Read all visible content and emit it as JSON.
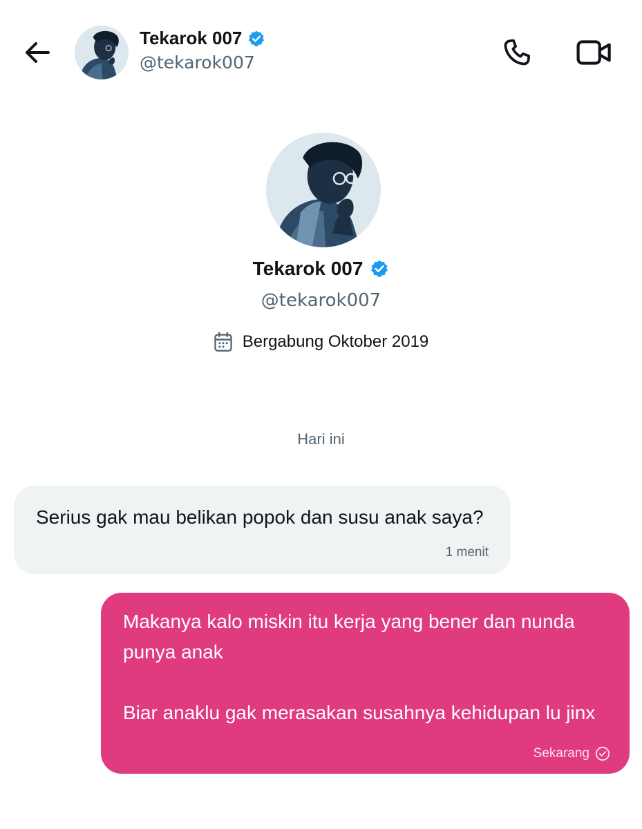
{
  "header": {
    "name": "Tekarok 007",
    "handle": "@tekarok007",
    "icons": {
      "back": "arrow-left-icon",
      "verified": "verified-badge-icon",
      "call": "phone-icon",
      "video": "video-camera-icon"
    }
  },
  "profile": {
    "name": "Tekarok 007",
    "handle": "@tekarok007",
    "joined": "Bergabung Oktober 2019",
    "joined_icon": "calendar-icon"
  },
  "conversation": {
    "day_label": "Hari ini",
    "messages": [
      {
        "direction": "incoming",
        "paragraphs": [
          "Serius gak mau belikan popok dan susu anak saya?"
        ],
        "time": "1 menit"
      },
      {
        "direction": "outgoing",
        "paragraphs": [
          "Makanya kalo miskin itu kerja yang bener dan nunda punya anak",
          "Biar anaklu gak merasakan susahnya kehidupan lu jinx"
        ],
        "time": "Sekarang",
        "status_icon": "sent-check-circle-icon"
      }
    ]
  },
  "colors": {
    "outgoing_bubble": "#e03b7f",
    "incoming_bubble": "#eff3f4",
    "verified": "#1d9bf0",
    "secondary_text": "#536471"
  }
}
